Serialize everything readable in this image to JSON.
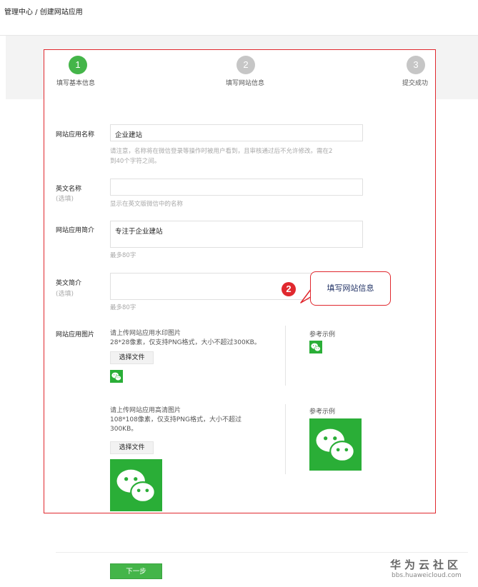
{
  "breadcrumb": "管理中心 / 创建网站应用",
  "steps": [
    {
      "num": "1",
      "label": "填写基本信息",
      "state": "active"
    },
    {
      "num": "2",
      "label": "填写网站信息",
      "state": "todo"
    },
    {
      "num": "3",
      "label": "提交成功",
      "state": "todo"
    }
  ],
  "form": {
    "app_name": {
      "label": "网站应用名称",
      "value": "企业建站",
      "hint_line1": "请注意，名称将在微信登录等操作时被用户看到，且审核通过后不允许修改。需在2",
      "hint_line2": "到40个字符之间。"
    },
    "english_name": {
      "label": "英文名称",
      "optional": "(选填)",
      "value": "",
      "hint": "显示在英文版微信中的名称"
    },
    "app_intro": {
      "label": "网站应用简介",
      "value": "专注于企业建站",
      "hint": "最多80字"
    },
    "english_intro": {
      "label": "英文简介",
      "optional": "(选填)",
      "value": "",
      "hint": "最多80字"
    },
    "app_image": {
      "label": "网站应用图片",
      "small": {
        "title": "请上传网站应用水印图片",
        "spec": "28*28像素，仅支持PNG格式，大小不超过300KB。",
        "button": "选择文件",
        "example_label": "参考示例"
      },
      "large": {
        "title": "请上传网站应用高清图片",
        "spec_line1": "108*108像素，仅支持PNG格式，大小不超过",
        "spec_line2": "300KB。",
        "button": "选择文件",
        "example_label": "参考示例"
      }
    }
  },
  "callout": {
    "badge": "2",
    "text": "填写网站信息"
  },
  "next_button": "下一步",
  "watermark": {
    "title": "华为云社区",
    "url": "bbs.huaweicloud.com"
  },
  "colors": {
    "accent_green": "#44b549",
    "highlight_red": "#e0282e",
    "wechat_green": "#2aae37"
  },
  "icons": {
    "wechat_logo": "wechat-logo-icon"
  }
}
